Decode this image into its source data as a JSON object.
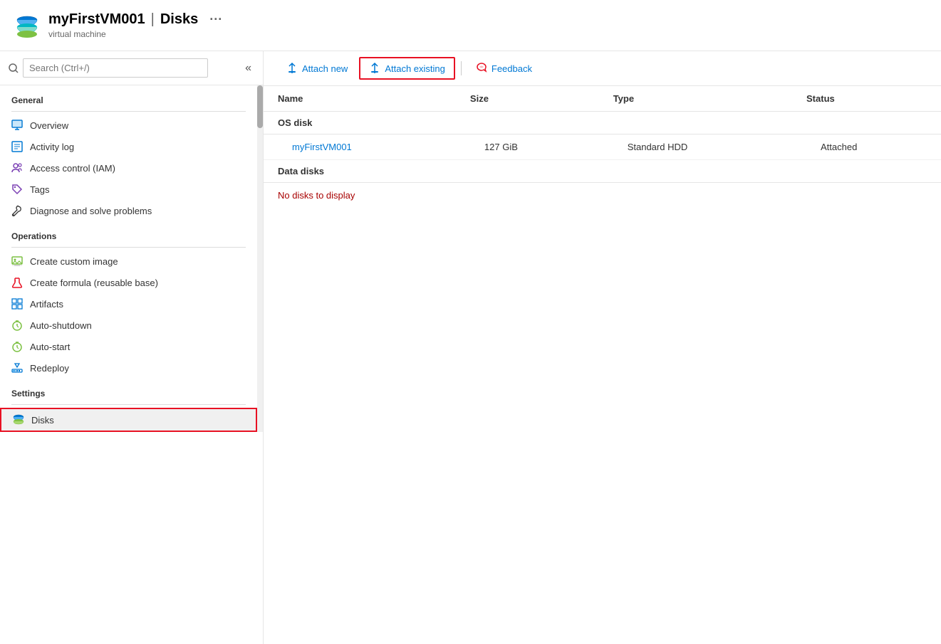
{
  "header": {
    "title": "myFirstVM001 | Disks",
    "resource_name": "myFirstVM001",
    "separator": "|",
    "page_name": "Disks",
    "subtitle": "virtual machine",
    "more_icon": "···"
  },
  "sidebar": {
    "search_placeholder": "Search (Ctrl+/)",
    "collapse_icon": "«",
    "sections": [
      {
        "label": "General",
        "items": [
          {
            "id": "overview",
            "label": "Overview",
            "icon": "monitor"
          },
          {
            "id": "activity-log",
            "label": "Activity log",
            "icon": "list"
          },
          {
            "id": "access-control",
            "label": "Access control (IAM)",
            "icon": "people"
          },
          {
            "id": "tags",
            "label": "Tags",
            "icon": "tag"
          },
          {
            "id": "diagnose",
            "label": "Diagnose and solve problems",
            "icon": "wrench"
          }
        ]
      },
      {
        "label": "Operations",
        "items": [
          {
            "id": "custom-image",
            "label": "Create custom image",
            "icon": "image"
          },
          {
            "id": "formula",
            "label": "Create formula (reusable base)",
            "icon": "beaker"
          },
          {
            "id": "artifacts",
            "label": "Artifacts",
            "icon": "grid"
          },
          {
            "id": "auto-shutdown",
            "label": "Auto-shutdown",
            "icon": "clock"
          },
          {
            "id": "auto-start",
            "label": "Auto-start",
            "icon": "clock2"
          },
          {
            "id": "redeploy",
            "label": "Redeploy",
            "icon": "deploy"
          }
        ]
      },
      {
        "label": "Settings",
        "items": [
          {
            "id": "disks",
            "label": "Disks",
            "icon": "disk",
            "active": true
          }
        ]
      }
    ]
  },
  "toolbar": {
    "attach_new_label": "Attach new",
    "attach_existing_label": "Attach existing",
    "feedback_label": "Feedback"
  },
  "disk_table": {
    "columns": [
      "Name",
      "Size",
      "Type",
      "Status"
    ],
    "os_disk_section": "OS disk",
    "os_disk": {
      "name": "myFirstVM001",
      "size": "127 GiB",
      "type": "Standard HDD",
      "status": "Attached"
    },
    "data_disk_section": "Data disks",
    "no_disks_message": "No disks to display"
  }
}
